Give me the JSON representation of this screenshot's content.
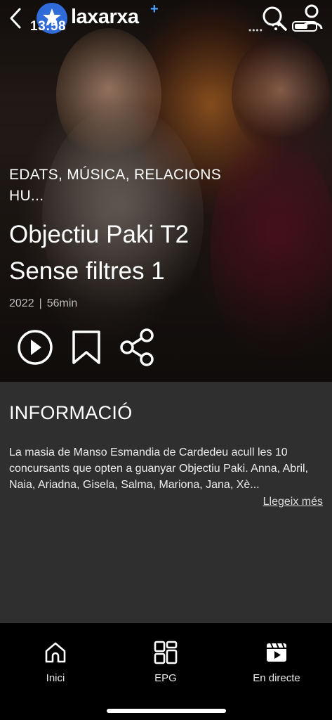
{
  "status_bar": {
    "time": "13:58"
  },
  "header": {
    "logo_text": "laxarxa",
    "logo_plus": "+"
  },
  "program": {
    "genres": "EDATS, MÚSICA, RELACIONS HU...",
    "title_line1": "Objectiu Paki T2",
    "title_line2": "Sense filtres 1",
    "year": "2022",
    "separator": "|",
    "duration": "56min"
  },
  "info": {
    "heading": "INFORMACIÓ",
    "description": "La masia de Manso Esmandia de Cardedeu acull les 10 concursants que opten a guanyar Objectiu Paki. Anna, Abril, Naia, Ariadna, Gisela, Salma, Mariona, Jana, Xè...",
    "read_more": "Llegeix més"
  },
  "bottom_nav": [
    {
      "label": "Inici",
      "icon": "home-icon"
    },
    {
      "label": "EPG",
      "icon": "grid-icon"
    },
    {
      "label": "En directe",
      "icon": "live-clapper-icon"
    }
  ],
  "colors": {
    "logo_blue": "#2f6bd9",
    "plus_blue": "#4aa3ff",
    "background": "#2f2f2f",
    "nav_background": "#000000"
  }
}
